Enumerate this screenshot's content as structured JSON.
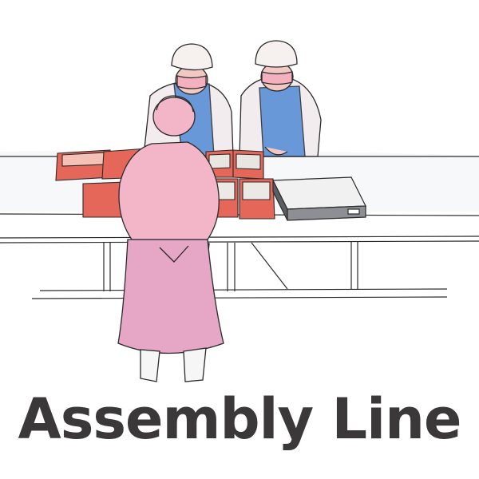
{
  "caption": {
    "title": "Assembly Line"
  },
  "illustration": {
    "subject": "workers-at-food-assembly-line",
    "style": "watercolor-sketch",
    "colors": {
      "apron_blue": "#5a8fd6",
      "smock_pink": "#f1b3c8",
      "tray_red": "#e5675a",
      "cap_white": "#f6f1ef",
      "scale_gray": "#8d8f95",
      "line": "#2b2b2b"
    }
  }
}
